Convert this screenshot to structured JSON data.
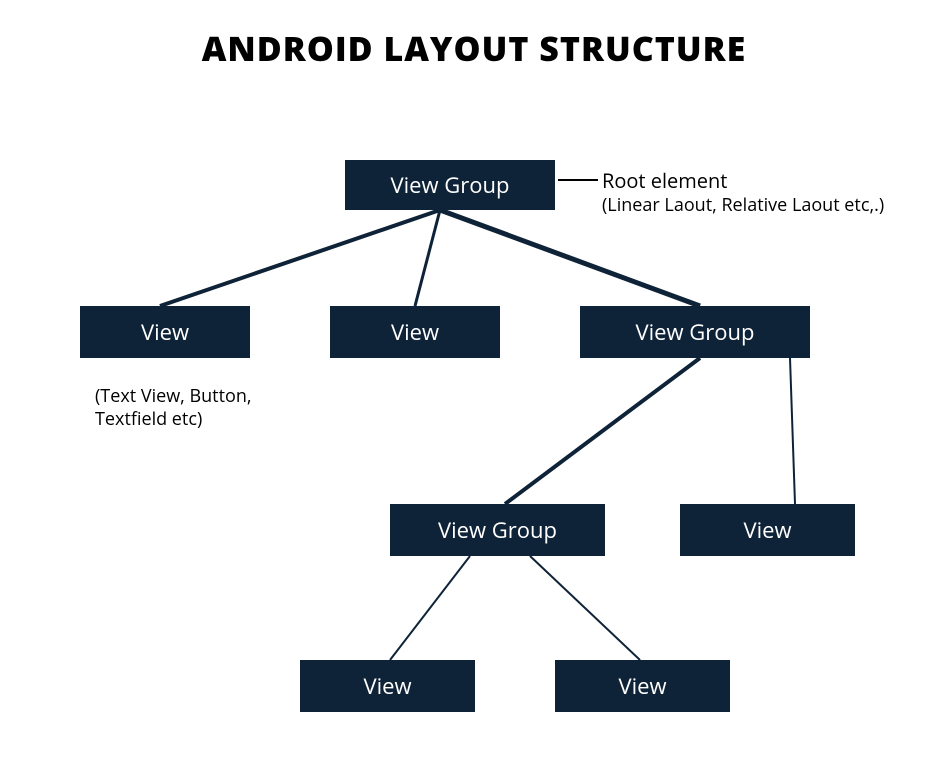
{
  "title": "ANDROID LAYOUT STRUCTURE",
  "nodes": {
    "root": "View Group",
    "l2_left": "View",
    "l2_mid": "View",
    "l2_right": "View Group",
    "l3_left": "View Group",
    "l3_right": "View",
    "l4_left": "View",
    "l4_right": "View"
  },
  "annotations": {
    "root_label": "Root element",
    "root_sub": "(Linear Laout, Relative Laout etc,.)",
    "view_sub": "(Text View, Button, Textfield etc)"
  },
  "colors": {
    "node_bg": "#0f2338",
    "node_fg": "#ffffff",
    "line": "#0f2338"
  }
}
